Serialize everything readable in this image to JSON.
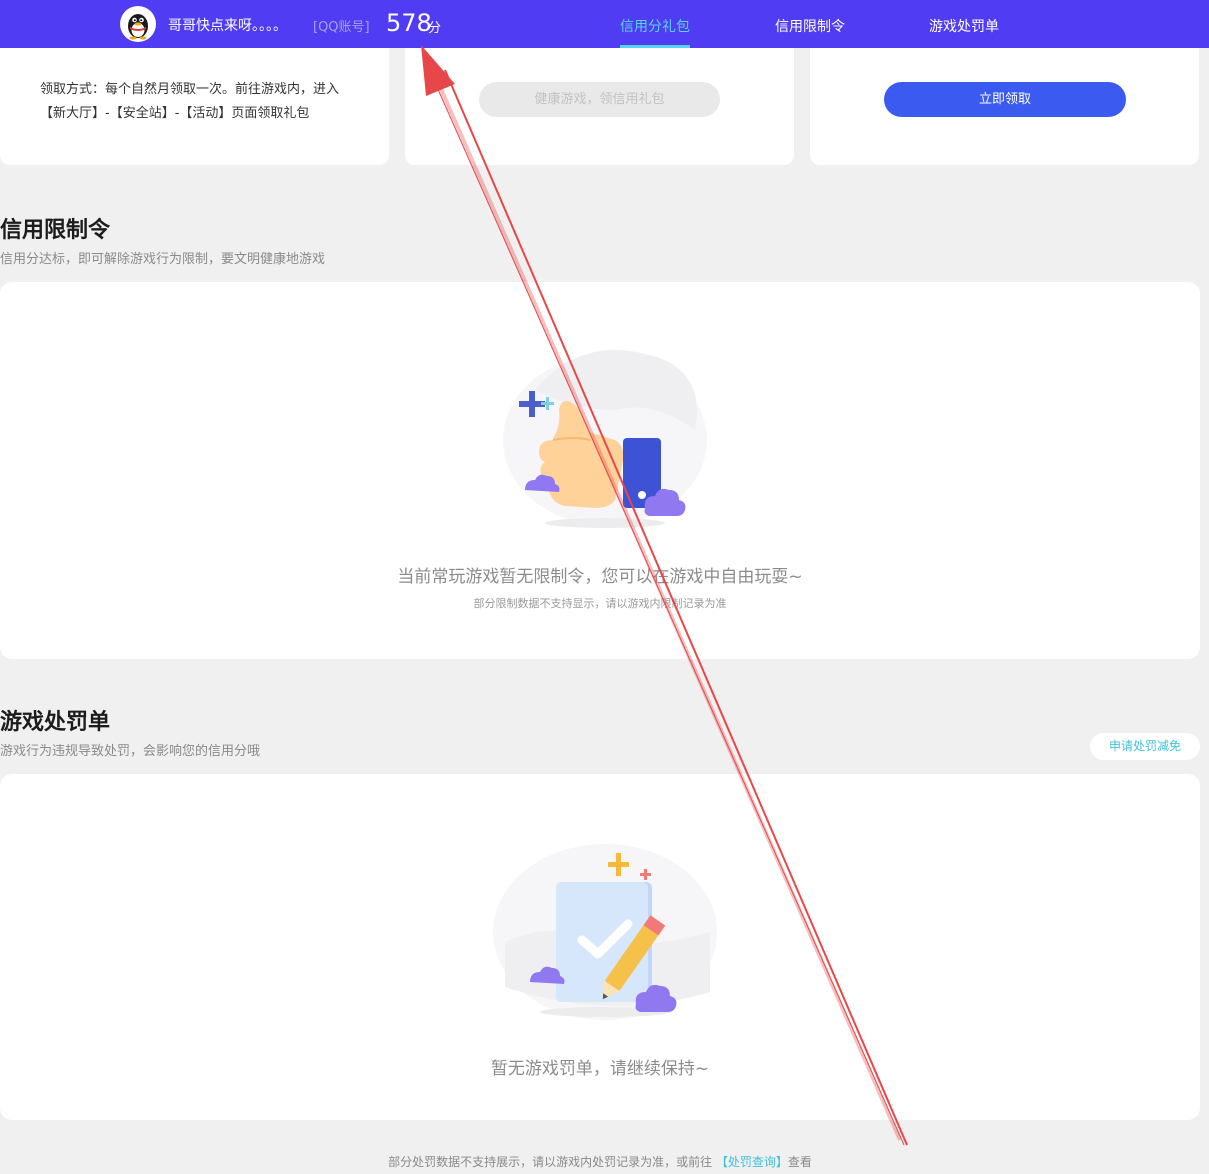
{
  "header": {
    "nickname": "哥哥快点来呀。。。。",
    "account_tag": "[QQ账号]",
    "score": "578",
    "score_unit": "分",
    "tabs": [
      {
        "label": "信用分礼包",
        "active": true
      },
      {
        "label": "信用限制令",
        "active": false
      },
      {
        "label": "游戏处罚单",
        "active": false
      }
    ]
  },
  "gift": {
    "claim_note": "领取方式：每个自然月领取一次。前往游戏内，进入【新大厅】-【安全站】-【活动】页面领取礼包",
    "disabled_button": "健康游戏，领信用礼包",
    "claim_button": "立即领取"
  },
  "restriction": {
    "title": "信用限制令",
    "subtitle": "信用分达标，即可解除游戏行为限制，要文明健康地游戏",
    "empty_main": "当前常玩游戏暂无限制令，您可以在游戏中自由玩耍~",
    "empty_sub": "部分限制数据不支持显示，请以游戏内限制记录为准"
  },
  "penalty": {
    "title": "游戏处罚单",
    "subtitle": "游戏行为违规导致处罚，会影响您的信用分哦",
    "apply_button": "申请处罚减免",
    "empty_main": "暂无游戏罚单，请继续保持~"
  },
  "footer": {
    "prefix": "部分处罚数据不支持展示，请以游戏内处罚记录为准，或前往",
    "link": "【处罚查询】",
    "suffix": "查看"
  },
  "colors": {
    "header_bg": "#4f3cf3",
    "active_tab": "#54d6ee",
    "primary_button": "#3b5bf0",
    "link": "#3fc3d8",
    "annotation": "#e8474a"
  }
}
